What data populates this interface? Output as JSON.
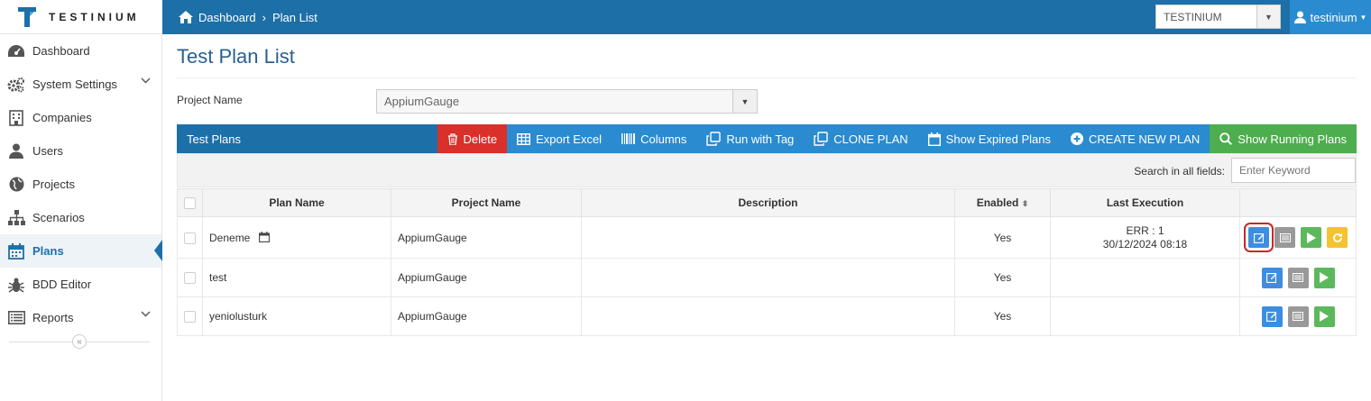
{
  "brand": {
    "name": "TESTINIUM"
  },
  "breadcrumb": {
    "home": "Dashboard",
    "current": "Plan List"
  },
  "header": {
    "project_select": "TESTINIUM",
    "user": "testinium"
  },
  "sidebar": {
    "items": [
      {
        "label": "Dashboard",
        "icon": "dashboard-icon"
      },
      {
        "label": "System Settings",
        "icon": "gears-icon",
        "expandable": true
      },
      {
        "label": "Companies",
        "icon": "building-icon"
      },
      {
        "label": "Users",
        "icon": "user-icon"
      },
      {
        "label": "Projects",
        "icon": "globe-icon"
      },
      {
        "label": "Scenarios",
        "icon": "sitemap-icon"
      },
      {
        "label": "Plans",
        "icon": "calendar-icon",
        "active": true
      },
      {
        "label": "BDD Editor",
        "icon": "bug-icon"
      },
      {
        "label": "Reports",
        "icon": "list-icon",
        "expandable": true
      }
    ]
  },
  "page": {
    "title": "Test Plan List",
    "project_label": "Project Name",
    "project_value": "AppiumGauge"
  },
  "toolbar": {
    "title": "Test Plans",
    "delete": "Delete",
    "export": "Export Excel",
    "columns": "Columns",
    "run_tag": "Run with Tag",
    "clone": "CLONE PLAN",
    "expired": "Show Expired Plans",
    "create": "CREATE NEW PLAN",
    "running": "Show Running Plans"
  },
  "search": {
    "label": "Search in all fields:",
    "placeholder": "Enter Keyword"
  },
  "table": {
    "headers": {
      "plan": "Plan Name",
      "project": "Project Name",
      "description": "Description",
      "enabled": "Enabled",
      "last": "Last Execution"
    },
    "rows": [
      {
        "plan": "Deneme",
        "project": "AppiumGauge",
        "description": "",
        "enabled": "Yes",
        "last_line1": "ERR : 1",
        "last_line2": "30/12/2024 08:18"
      },
      {
        "plan": "test",
        "project": "AppiumGauge",
        "description": "",
        "enabled": "Yes",
        "last_line1": "",
        "last_line2": ""
      },
      {
        "plan": "yeniolusturk",
        "project": "AppiumGauge",
        "description": "",
        "enabled": "Yes",
        "last_line1": "",
        "last_line2": ""
      }
    ]
  },
  "colors": {
    "primary": "#1d6fa8",
    "danger": "#d9302c",
    "accent": "#2a8bd0",
    "success": "#4ead4e"
  }
}
